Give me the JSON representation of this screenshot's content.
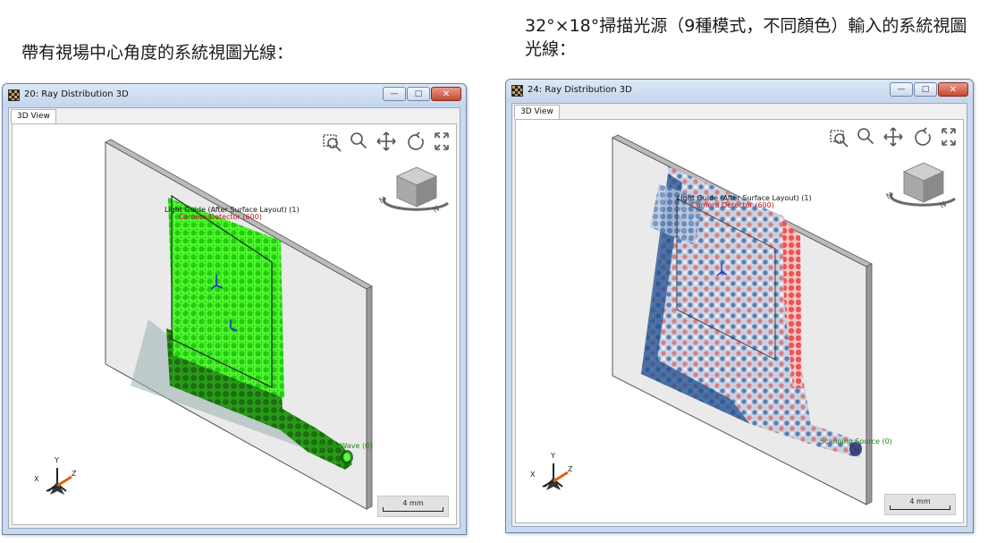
{
  "captions": {
    "left": "帶有視場中心角度的系統視圖光線：",
    "right": "32°×18°掃描光源（9種模式，不同顏色）輸入的系統視圖光線："
  },
  "windows": [
    {
      "title": "20: Ray Distribution 3D",
      "tab": "3D View",
      "labels": {
        "light_guide": "Light Guide (After Surface Layout) (1)",
        "detector": "Camera Detector (600)",
        "source": "Plane Wave (0)"
      },
      "scale": "4 mm",
      "ray_color": "#33ee11"
    },
    {
      "title": "24: Ray Distribution 3D",
      "tab": "3D View",
      "labels": {
        "light_guide": "Light Guide (After Surface Layout) (1)",
        "detector": "Camera Detector (600)",
        "source": "Scanning Source (0)"
      },
      "scale": "4 mm",
      "ray_colors": [
        "#1f4f8f",
        "#e83030"
      ]
    }
  ],
  "axes": {
    "x": "X",
    "y": "Y",
    "z": "Z"
  },
  "toolbar_icons": [
    "zoom-window-icon",
    "zoom-icon",
    "pan-icon",
    "rotate-icon",
    "fit-view-icon"
  ],
  "window_controls": {
    "minimize": "—",
    "maximize": "□",
    "close": "✕"
  }
}
